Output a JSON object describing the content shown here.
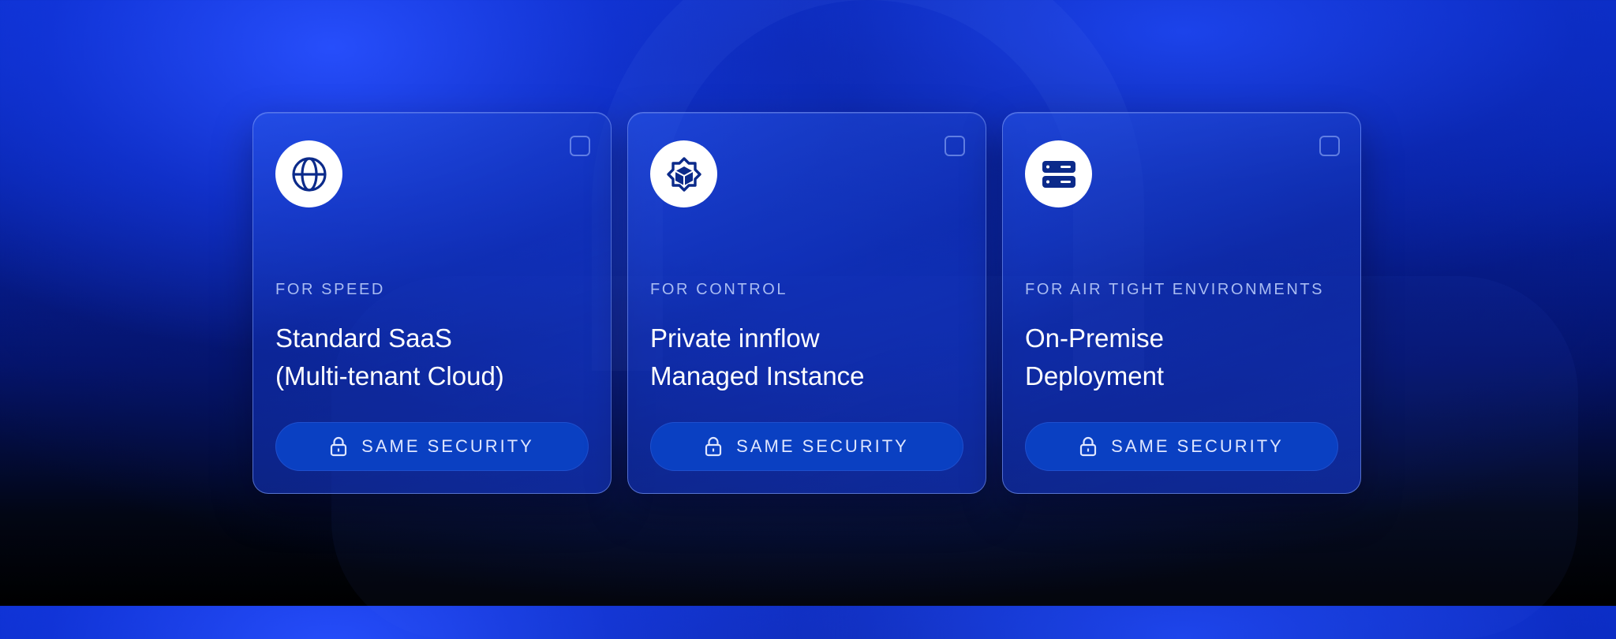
{
  "theme": {
    "accent": "#0a40c2",
    "text_primary": "#ffffff",
    "text_eyebrow": "#a9bcf2"
  },
  "cards": [
    {
      "icon": "globe-icon",
      "eyebrow": "FOR SPEED",
      "title_line1": "Standard SaaS",
      "title_line2": "(Multi-tenant Cloud)",
      "badge_icon": "lock-icon",
      "badge_label": "SAME SECURITY",
      "checked": false
    },
    {
      "icon": "cube-gear-icon",
      "eyebrow": "FOR CONTROL",
      "title_line1": "Private innflow",
      "title_line2": "Managed Instance",
      "badge_icon": "lock-icon",
      "badge_label": "SAME SECURITY",
      "checked": false
    },
    {
      "icon": "server-icon",
      "eyebrow": "FOR AIR TIGHT ENVIRONMENTS",
      "title_line1": "On-Premise",
      "title_line2": "Deployment",
      "badge_icon": "lock-icon",
      "badge_label": "SAME SECURITY",
      "checked": false
    }
  ]
}
